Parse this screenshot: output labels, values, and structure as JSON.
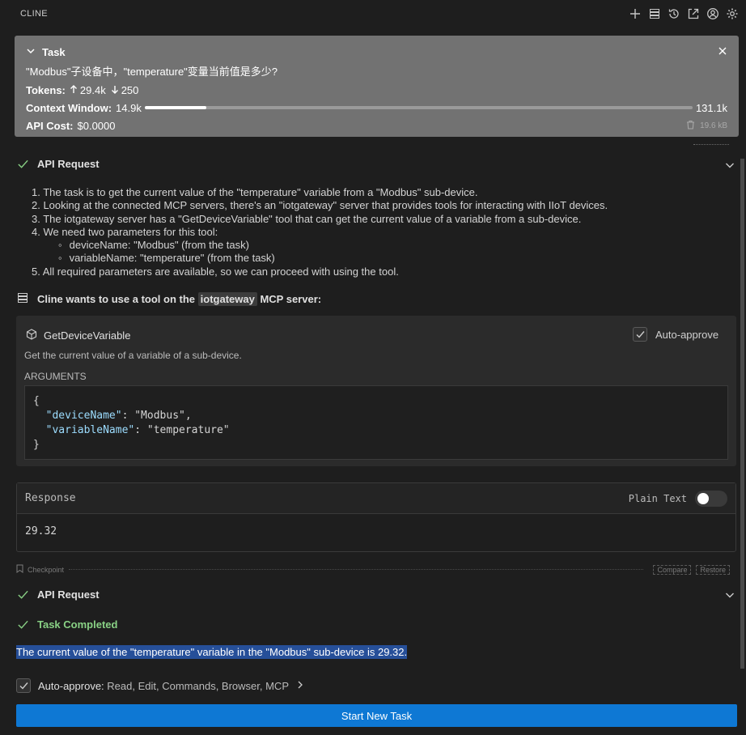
{
  "header": {
    "title": "CLINE",
    "icons": [
      "plus-icon",
      "server-icon",
      "history-icon",
      "popout-icon",
      "account-icon",
      "settings-icon"
    ]
  },
  "task": {
    "title": "Task",
    "question": "\"Modbus\"子设备中，\"temperature\"变量当前值是多少?",
    "tokens_label": "Tokens:",
    "tokens_up": "29.4k",
    "tokens_down": "250",
    "context_label": "Context Window:",
    "context_used": "14.9k",
    "context_max": "131.1k",
    "context_fraction": 0.113,
    "cost_label": "API Cost:",
    "cost_value": "$0.0000",
    "size": "19.6 kB"
  },
  "api_request_1": {
    "label": "API Request"
  },
  "reasoning": [
    "1. The task is to get the current value of the \"temperature\" variable from a \"Modbus\" sub-device.",
    "2. Looking at the connected MCP servers, there's an \"iotgateway\" server that provides tools for interacting with IIoT devices.",
    "3. The iotgateway server has a \"GetDeviceVariable\" tool that can get the current value of a variable from a sub-device.",
    "4. We need two parameters for this tool:",
    "deviceName: \"Modbus\" (from the task)",
    "variableName: \"temperature\" (from the task)",
    "5. All required parameters are available, so we can proceed with using the tool."
  ],
  "mcp": {
    "prefix": "Cline wants to use a tool on the",
    "server": "iotgateway",
    "suffix": "MCP server:"
  },
  "tool": {
    "name": "GetDeviceVariable",
    "auto_approve": "Auto-approve",
    "description": "Get the current value of a variable of a sub-device.",
    "args_label": "ARGUMENTS",
    "args": {
      "open": "{",
      "k1": "\"deviceName\"",
      "v1": "\"Modbus\"",
      "k2": "\"variableName\"",
      "v2": "\"temperature\"",
      "close": "}"
    }
  },
  "response": {
    "title": "Response",
    "plain_text": "Plain Text",
    "plain_text_on": false,
    "value": "29.32"
  },
  "checkpoint": {
    "label": "Checkpoint",
    "compare": "Compare",
    "restore": "Restore"
  },
  "api_request_2": {
    "label": "API Request"
  },
  "task_completed": {
    "label": "Task Completed"
  },
  "result_text": "The current value of the \"temperature\" variable in the \"Modbus\" sub-device is 29.32.",
  "auto_approve_bar": {
    "label": "Auto-approve:",
    "items": "Read, Edit, Commands, Browser, MCP"
  },
  "start_button": "Start New Task",
  "colors": {
    "accent": "#0e78d4",
    "success": "#89d185",
    "task_bg": "#727272",
    "selection": "#264f99"
  }
}
